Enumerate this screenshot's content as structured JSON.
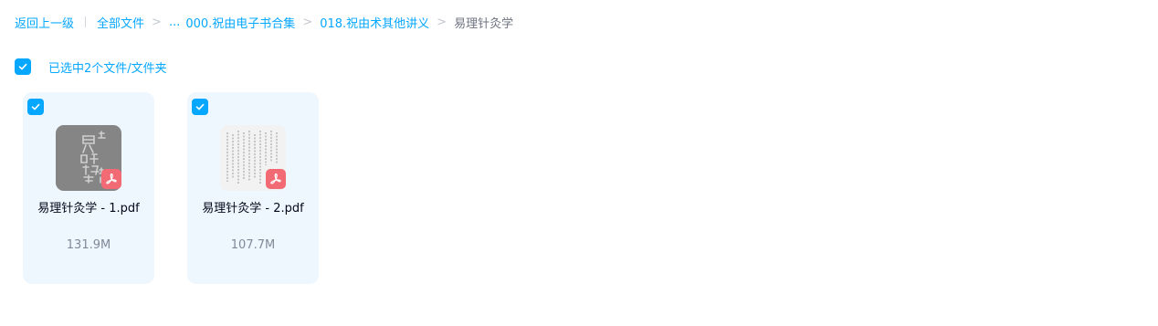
{
  "breadcrumb": {
    "back": "返回上一级",
    "all_files": "全部文件",
    "separator": ">",
    "ellipsis": "...",
    "crumbs": [
      "000.祝由电子书合集",
      "018.祝由术其他讲义"
    ],
    "current": "易理针灸学"
  },
  "selection": {
    "text": "已选中2个文件/文件夹",
    "checked": true
  },
  "files": [
    {
      "name": "易理针灸学 - 1.pdf",
      "size": "131.9M",
      "type": "pdf",
      "checked": true
    },
    {
      "name": "易理针灸学 - 2.pdf",
      "size": "107.7M",
      "type": "pdf",
      "checked": true
    }
  ],
  "colors": {
    "accent": "#06a7ff",
    "card_bg": "#eef7fd",
    "pdf_badge": "#f26a73",
    "text_primary": "#03081a",
    "text_secondary": "#818999"
  },
  "icons": {
    "checkbox": "check-icon",
    "file_type": "pdf-icon"
  }
}
